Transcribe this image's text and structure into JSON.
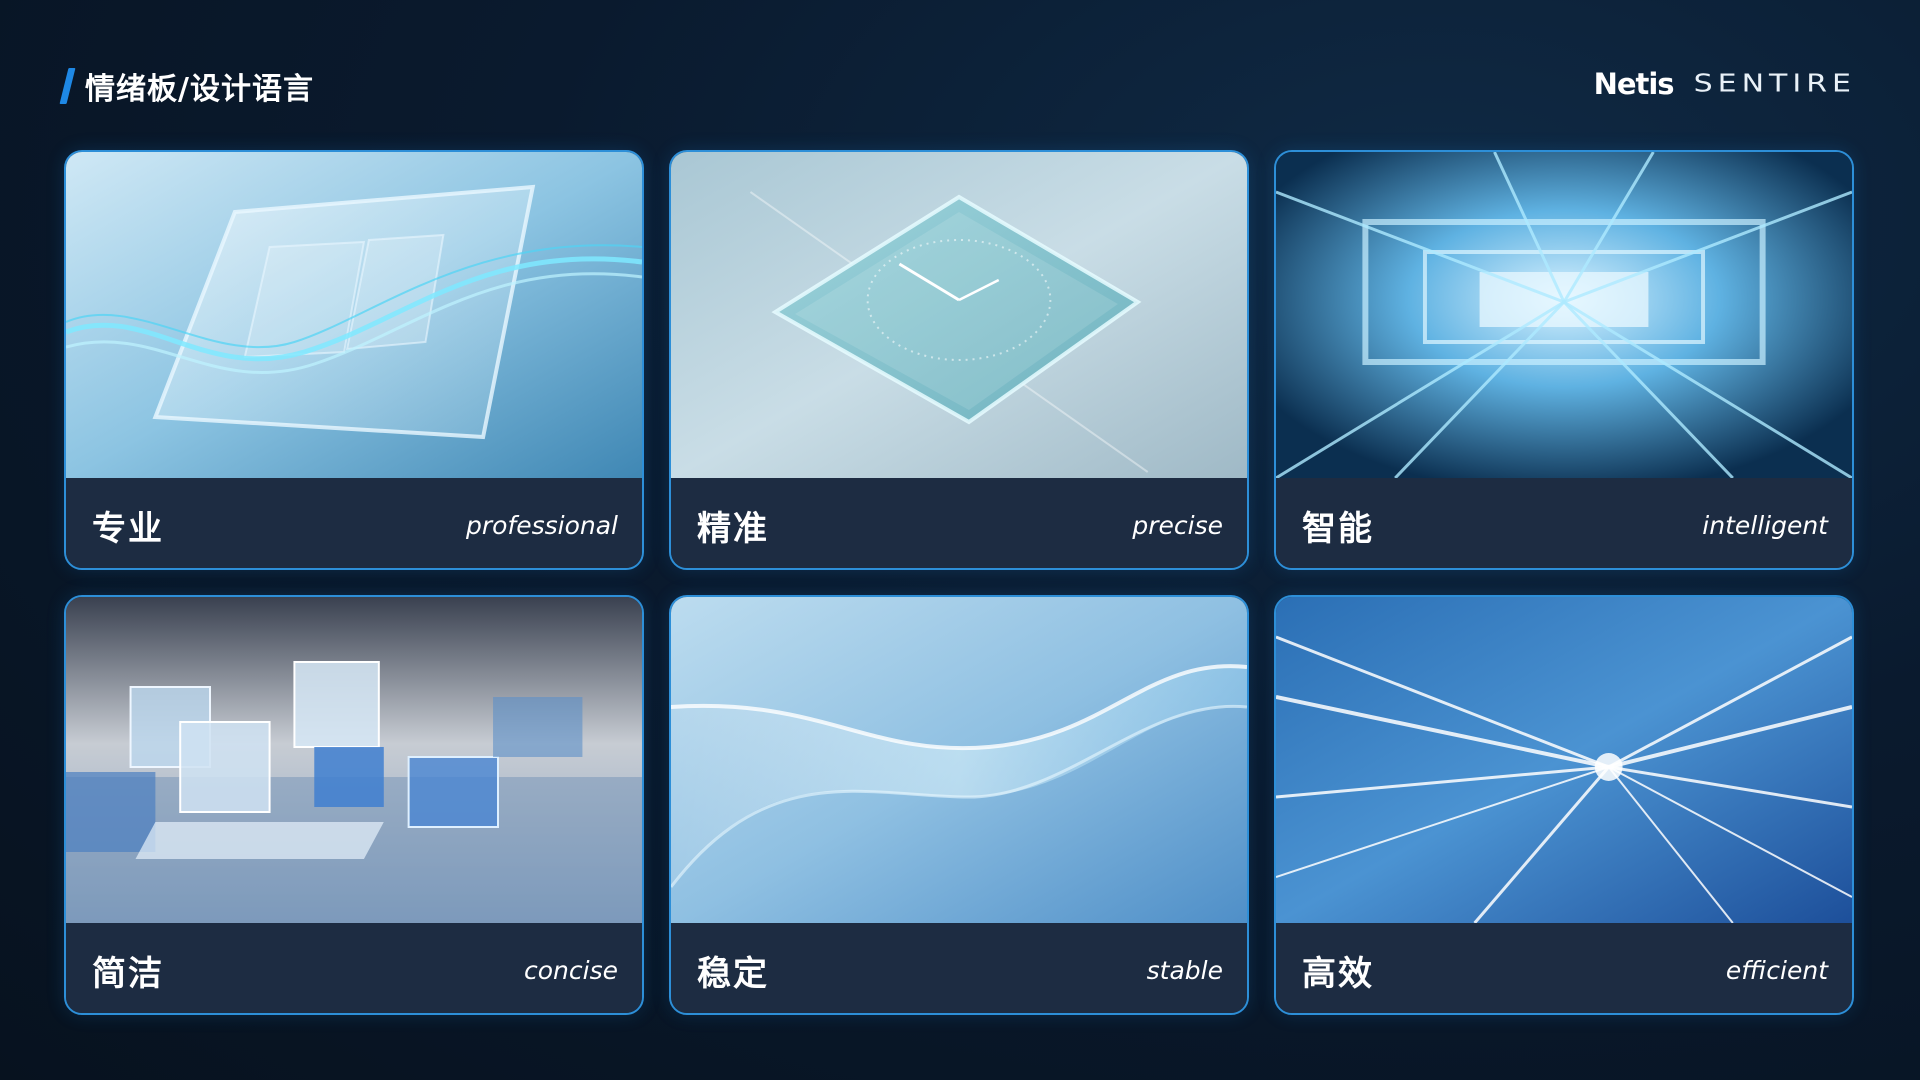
{
  "header": {
    "title": "情绪板/设计语言",
    "brand_primary": "Netis",
    "brand_secondary": "SENTIRE"
  },
  "colors": {
    "background": "#0a1a2e",
    "accent": "#1e88e5",
    "card_border": "#2d8fd8",
    "card_footer": "#1d2c42"
  },
  "cards": [
    {
      "title_zh": "专业",
      "title_en": "professional",
      "image": "glass-panel-wave-image"
    },
    {
      "title_zh": "精准",
      "title_en": "precise",
      "image": "glass-clock-image"
    },
    {
      "title_zh": "智能",
      "title_en": "intelligent",
      "image": "light-tunnel-image"
    },
    {
      "title_zh": "简洁",
      "title_en": "concise",
      "image": "glass-cubes-image"
    },
    {
      "title_zh": "稳定",
      "title_en": "stable",
      "image": "flowing-ribbon-image"
    },
    {
      "title_zh": "高效",
      "title_en": "efficient",
      "image": "speed-light-rays-image"
    }
  ]
}
